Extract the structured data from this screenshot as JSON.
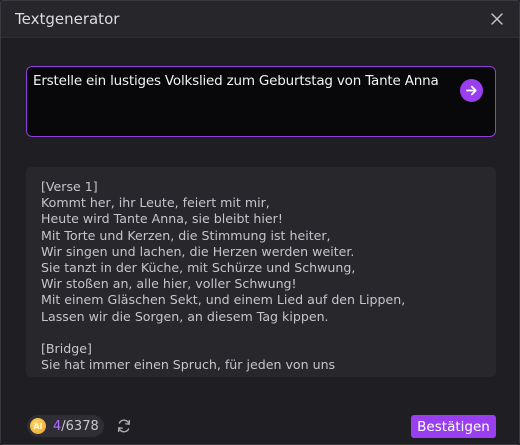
{
  "window": {
    "title": "Textgenerator"
  },
  "prompt": {
    "text": "Erstelle ein lustiges Volkslied zum Geburtstag von Tante Anna"
  },
  "output": {
    "lines": [
      "[Verse 1]",
      "Kommt her, ihr Leute, feiert mit mir,",
      "Heute wird Tante Anna, sie bleibt hier!",
      "Mit Torte und Kerzen, die Stimmung ist heiter,",
      "Wir singen und lachen, die Herzen werden weiter.",
      "Sie tanzt in der Küche, mit Schürze und Schwung,",
      "Wir stoßen an, alle hier, voller Schwung!",
      "Mit einem Gläschen Sekt, und einem Lied auf den Lippen,",
      "Lassen wir die Sorgen, an diesem Tag kippen.",
      "",
      "[Bridge]",
      "Sie hat immer einen Spruch, für jeden von uns"
    ]
  },
  "footer": {
    "coin_label": "AI",
    "credits_used": "4",
    "credits_total": "/6378",
    "confirm_label": "Bestätigen"
  },
  "colors": {
    "accent": "#9a3ff0",
    "prompt_border": "#8e3fd8",
    "background": "#1f1e23"
  },
  "icons": {
    "close": "close-icon",
    "send": "arrow-right-icon",
    "coin": "ai-coin-icon",
    "refresh": "refresh-icon"
  }
}
